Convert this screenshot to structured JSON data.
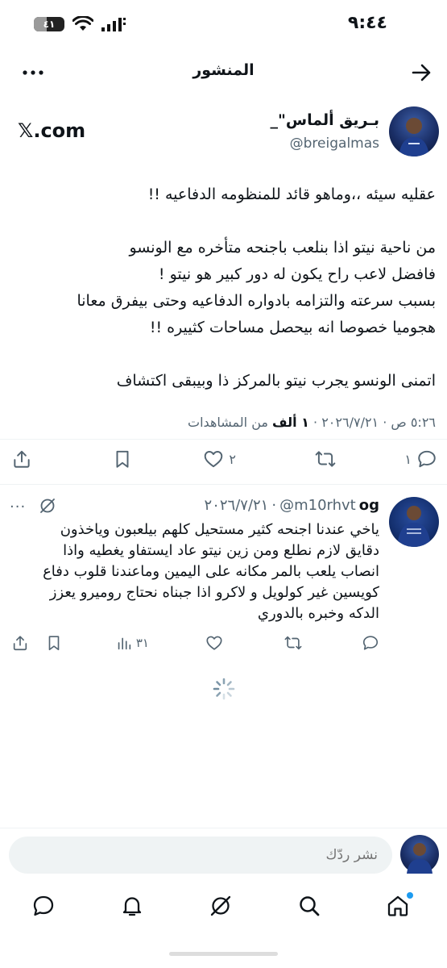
{
  "status_bar": {
    "time": "٩:٤٤",
    "battery_label": "٤١",
    "battery_level": 0.41
  },
  "header": {
    "title": "المنشور"
  },
  "author": {
    "name": "بـريق ألماس\"_",
    "handle": "@breigalmas",
    "source": "𝕏.com"
  },
  "tweet": {
    "lines": [
      "عقليه سيئه ،،وماهو قائد للمنظومه الدفاعيه !!",
      "",
      "من ناحية نيتو اذا بنلعب باجنحه متأخره مع الونسو",
      "فافضل لاعب راح يكون له دور كبير هو نيتو !",
      "بسبب سرعته والتزامه بادواره الدفاعيه وحتى بيفرق معانا",
      "هجوميا خصوصا انه بيحصل مساحات كثييره !!",
      "",
      "اتمنى الونسو يجرب نيتو بالمركز ذا وبيبقى اكتشاف"
    ],
    "timestamp": "٥:٢٦ ص · ٢٠٢٦/٧/٢١ ·",
    "views_count": "١ ألف",
    "views_label": "من المشاهدات"
  },
  "tweet_actions": {
    "reply_count": "١",
    "like_count": "٢"
  },
  "reply": {
    "name": "og",
    "handle": "@m10rhvt",
    "date": "٢٠٢٦/٧/٢١",
    "more": "···",
    "lines": [
      "ياخي عندنا اجنحه كثير مستحيل كلهم بيلعبون وياخذون",
      "دقايق لازم نطلع ومن زين نيتو عاد ايستفاو يغطيه واذا",
      "انصاب يلعب بالمر مكانه على اليمين وماعندنا قلوب دفاع",
      "كويسين غير كولويل و لاكرو اذا جبناه نحتاج روميرو يعزز",
      "الدكه وخبره بالدوري"
    ],
    "views": "٣١"
  },
  "compose": {
    "placeholder": "نشر ردّك"
  },
  "icons": {
    "back": "arrow-right-icon",
    "more": "more-dots-icon",
    "reply": "comment-icon",
    "retweet": "repost-icon",
    "like": "heart-icon",
    "bookmark": "bookmark-icon",
    "share": "share-icon",
    "views": "bar-chart-icon",
    "grok": "grok-icon",
    "home": "home-icon",
    "search": "search-icon",
    "notifications": "bell-icon",
    "messages": "message-icon"
  },
  "colors": {
    "text": "#0f1419",
    "muted": "#536471",
    "accent": "#1d9bf0",
    "divider": "#eff3f4"
  }
}
